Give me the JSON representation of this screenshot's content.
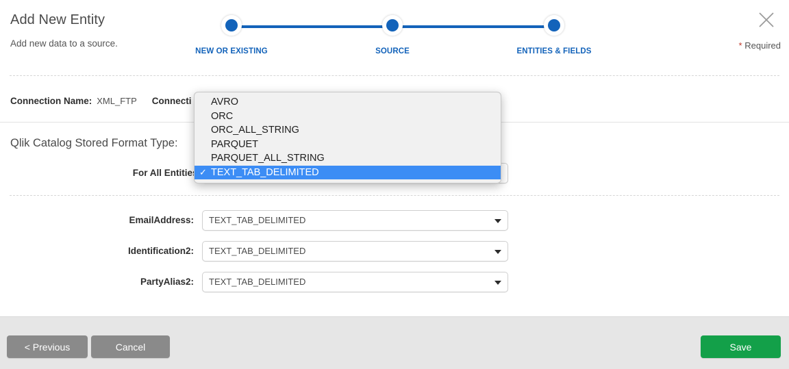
{
  "header": {
    "title": "Add New Entity",
    "subtitle": "Add new data to a source.",
    "close_icon": "close-icon",
    "required_star": "*",
    "required_label": "Required"
  },
  "stepper": {
    "steps": [
      {
        "label": "NEW OR EXISTING",
        "state": "complete"
      },
      {
        "label": "SOURCE",
        "state": "complete"
      },
      {
        "label": "ENTITIES & FIELDS",
        "state": "active"
      }
    ],
    "accent_color": "#1363ba"
  },
  "connection": {
    "name_label": "Connection Name:",
    "name_value": "XML_FTP",
    "type_label": "Connecti"
  },
  "format_section": {
    "heading": "Qlik Catalog Stored Format Type:",
    "all_entities_label": "For All Entities:",
    "all_entities_value": "TEXT_TAB_DELIMITED"
  },
  "dropdown": {
    "open": true,
    "selected": "TEXT_TAB_DELIMITED",
    "check_glyph": "✓",
    "highlight_color": "#3c8df5",
    "options": [
      "AVRO",
      "ORC",
      "ORC_ALL_STRING",
      "PARQUET",
      "PARQUET_ALL_STRING",
      "TEXT_TAB_DELIMITED"
    ]
  },
  "entity_fields": [
    {
      "label": "EmailAddress:",
      "value": "TEXT_TAB_DELIMITED"
    },
    {
      "label": "Identification2:",
      "value": "TEXT_TAB_DELIMITED"
    },
    {
      "label": "PartyAlias2:",
      "value": "TEXT_TAB_DELIMITED"
    }
  ],
  "footer": {
    "previous_label": "< Previous",
    "cancel_label": "Cancel",
    "save_label": "Save",
    "save_color": "#13a049",
    "neutral_color": "#8a8a8a"
  }
}
